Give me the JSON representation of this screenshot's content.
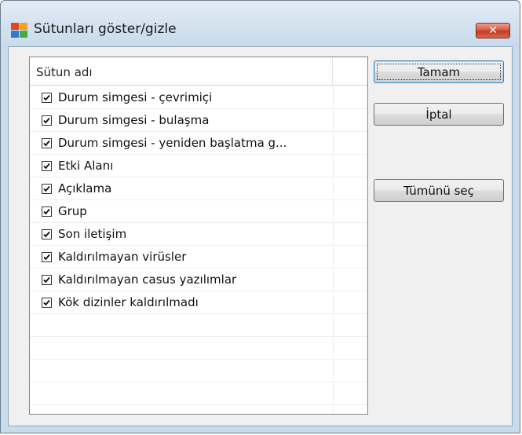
{
  "window": {
    "title": "Sütunları göster/gizle",
    "close_symbol": "✕",
    "app_icon": "avg-logo-icon"
  },
  "list": {
    "column_header": "Sütun adı",
    "items": [
      {
        "label": "Durum simgesi - çevrimiçi",
        "checked": true
      },
      {
        "label": "Durum simgesi - bulaşma",
        "checked": true
      },
      {
        "label": "Durum simgesi - yeniden başlatma g...",
        "checked": true
      },
      {
        "label": "Etki Alanı",
        "checked": true
      },
      {
        "label": "Açıklama",
        "checked": true
      },
      {
        "label": "Grup",
        "checked": true
      },
      {
        "label": "Son iletişim",
        "checked": true
      },
      {
        "label": "Kaldırılmayan virüsler",
        "checked": true
      },
      {
        "label": "Kaldırılmayan casus yazılımlar",
        "checked": true
      },
      {
        "label": "Kök dizinler kaldırılmadı",
        "checked": true
      }
    ]
  },
  "buttons": {
    "ok": "Tamam",
    "cancel": "İptal",
    "select_all": "Tümünü seç"
  },
  "colors": {
    "close_button": "#c23a22",
    "dialog_background": "#f0f0f0",
    "title_bar": "#c8daea"
  }
}
